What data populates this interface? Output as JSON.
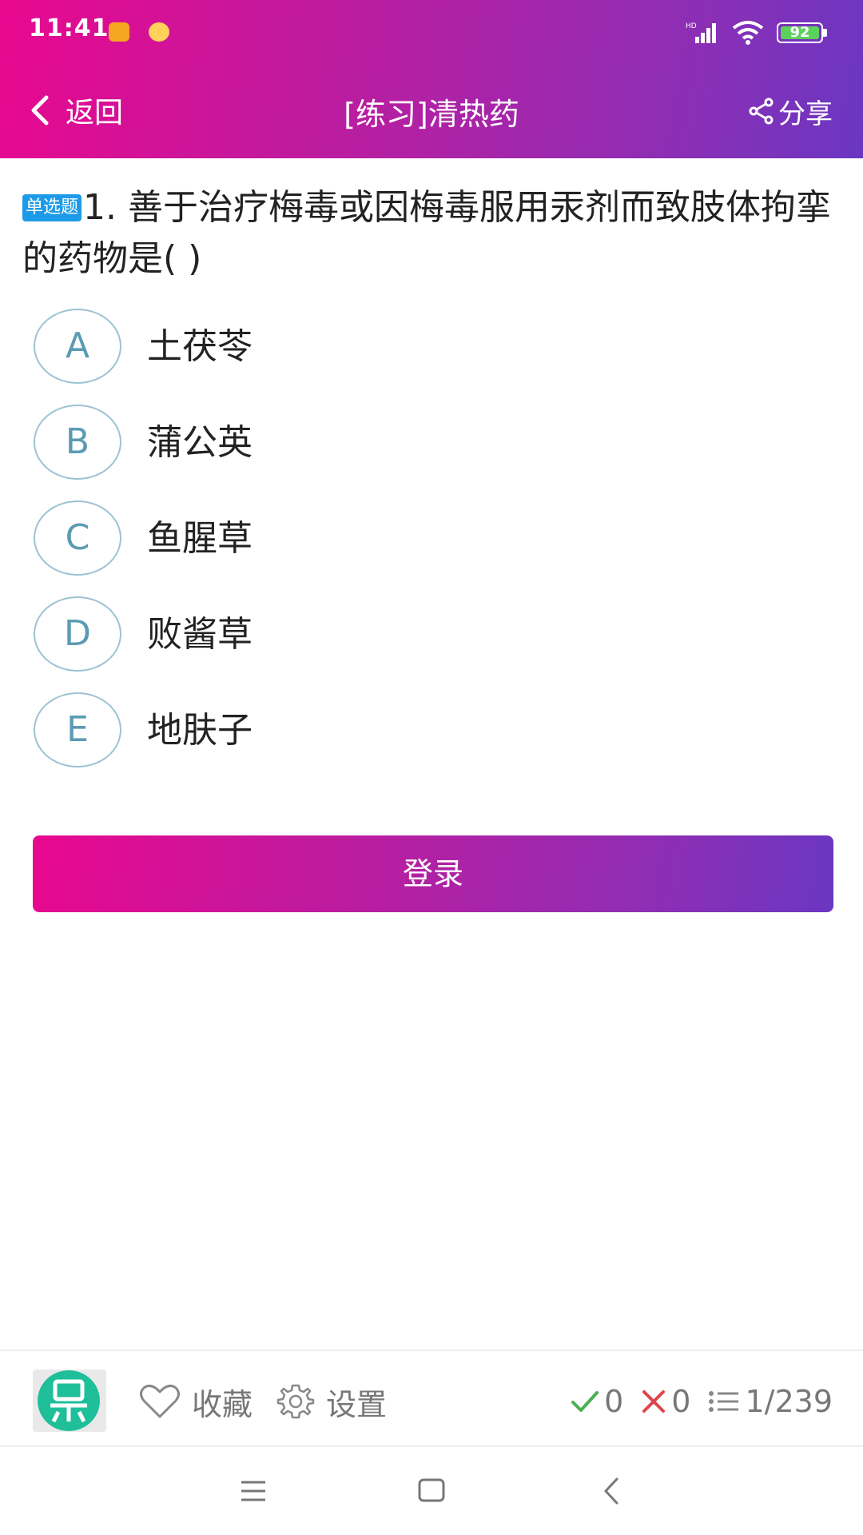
{
  "status_bar": {
    "time": "11:41",
    "network_label": "HD",
    "battery_level": "92"
  },
  "nav": {
    "back_label": "返回",
    "title": "[练习]清热药",
    "share_label": "分享"
  },
  "question": {
    "type_badge": "单选题",
    "text": "1. 善于治疗梅毒或因梅毒服用汞剂而致肢体拘挛的药物是( )"
  },
  "options": [
    {
      "letter": "A",
      "text": "土茯苓"
    },
    {
      "letter": "B",
      "text": "蒲公英"
    },
    {
      "letter": "C",
      "text": "鱼腥草"
    },
    {
      "letter": "D",
      "text": "败酱草"
    },
    {
      "letter": "E",
      "text": "地肤子"
    }
  ],
  "login_button": {
    "label": "登录"
  },
  "bottom_bar": {
    "favorite_label": "收藏",
    "settings_label": "设置",
    "correct_count": "0",
    "wrong_count": "0",
    "progress": "1/239"
  },
  "colors": {
    "header_start": "#e8088f",
    "header_end": "#6a37c2",
    "badge_blue": "#1e9be8",
    "option_letter": "#5b9bb3",
    "correct_green": "#4caf50",
    "wrong_red": "#e0444b"
  }
}
